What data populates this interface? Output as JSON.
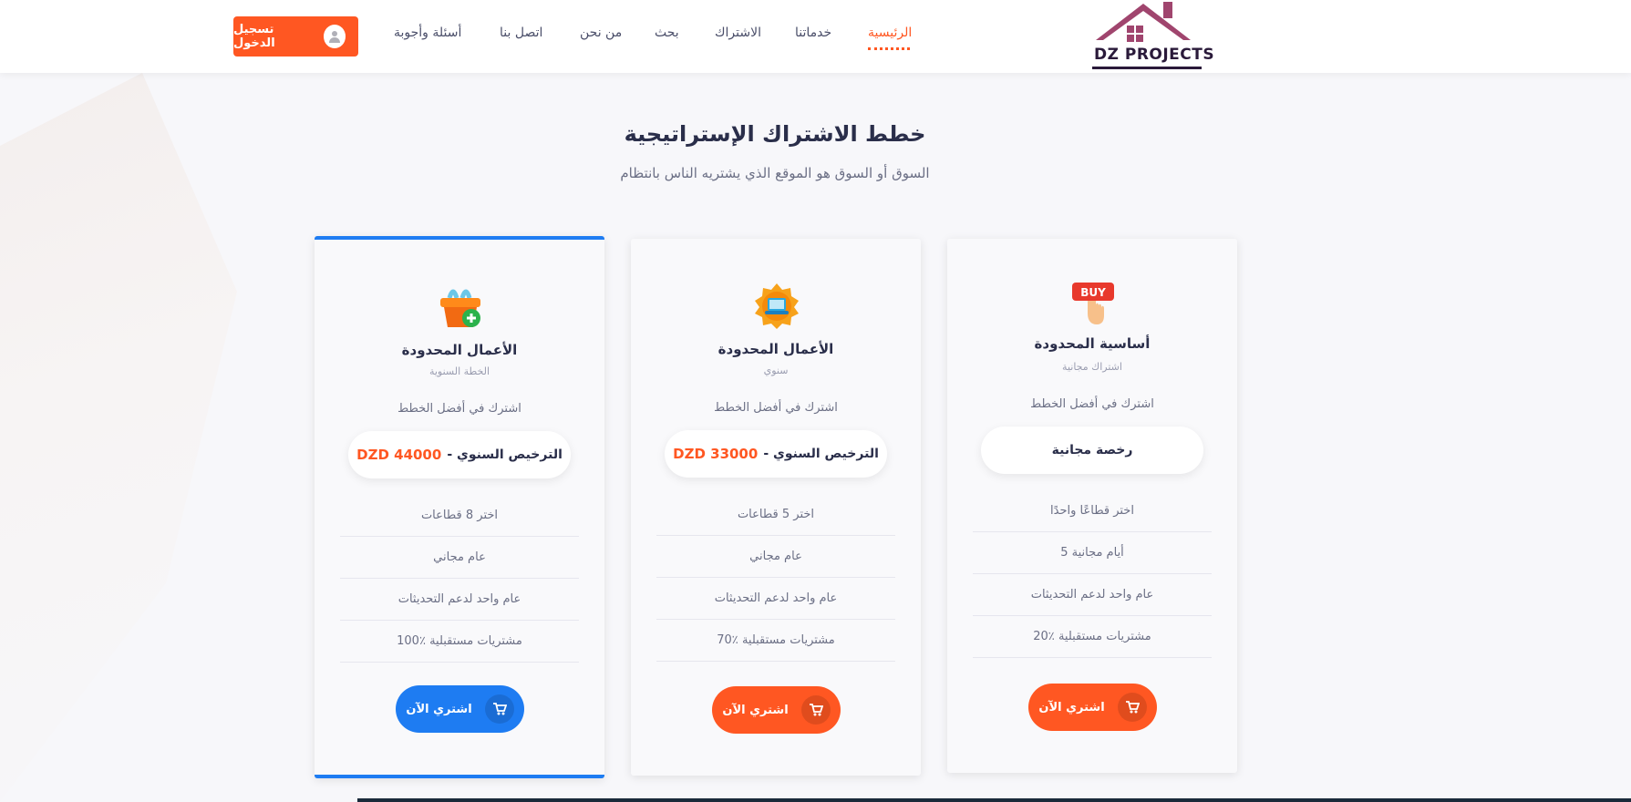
{
  "brand": {
    "name": "DZ PROJECTS",
    "color": "#a0456e"
  },
  "nav": {
    "items": [
      {
        "label": "الرئيسية",
        "active": true
      },
      {
        "label": "خدماتنا"
      },
      {
        "label": "الاشتراك"
      },
      {
        "label": "بحث"
      },
      {
        "label": "من نحن"
      },
      {
        "label": "اتصل بنا"
      },
      {
        "label": "أسئلة وأجوبة"
      }
    ],
    "login_label": "تسجيل الدخول"
  },
  "section": {
    "title": "خطط الاشتراك الإستراتيجية",
    "subtitle": "السوق أو السوق هو الموقع الذي يشتريه الناس بانتظام"
  },
  "plans": [
    {
      "name": "الأعمال المحدودة",
      "period": "الخطة السنوية",
      "tagline": "اشترك في أفضل الخطط",
      "price_label": "الترخيص السنوي -",
      "price_amount": "DZD 44000",
      "features": [
        "اختر 8 قطاعات",
        "عام مجاني",
        "عام واحد لدعم التحديثات",
        "100٪ مشتريات مستقبلية"
      ],
      "buy_label": "اشتري الآن",
      "icon": "basket-icon",
      "accent": "#1e7cf2"
    },
    {
      "name": "الأعمال المحدودة",
      "period": "سنوي",
      "tagline": "اشترك في أفضل الخطط",
      "price_label": "الترخيص السنوي -",
      "price_amount": "DZD 33000",
      "features": [
        "اختر 5 قطاعات",
        "عام مجاني",
        "عام واحد لدعم التحديثات",
        "70٪ مشتريات مستقبلية"
      ],
      "buy_label": "اشتري الآن",
      "icon": "laptop-badge-icon",
      "accent": "#ff5722"
    },
    {
      "name": "أساسية المحدودة",
      "period": "اشتراك مجانية",
      "tagline": "اشترك في أفضل الخطط",
      "price_label": "رخصة مجانية",
      "price_amount": "",
      "features": [
        "اختر قطاعًا واحدًا",
        "5 أيام مجانية",
        "عام واحد لدعم التحديثات",
        "20٪ مشتريات مستقبلية"
      ],
      "buy_label": "اشتري الآن",
      "icon": "buy-sign-icon",
      "buy_sign": "BUY",
      "accent": "#ff5722"
    }
  ]
}
